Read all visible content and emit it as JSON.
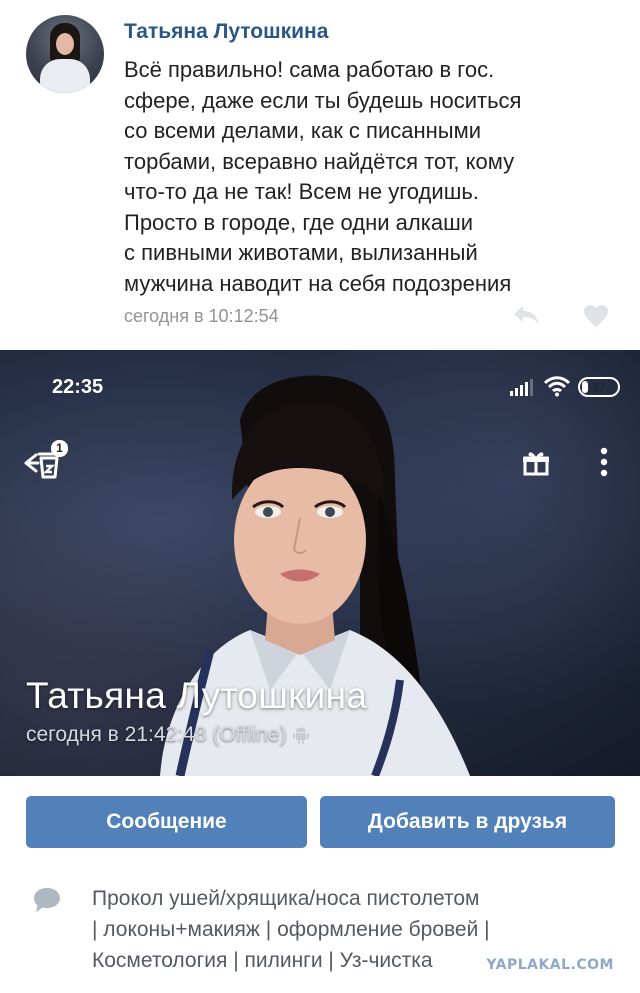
{
  "comment": {
    "author": "Татьяна Лутошкина",
    "lines": [
      "Всё правильно! сама работаю в гос.",
      "сфере, даже если ты будешь носиться",
      "со всеми делами, как с писанными",
      "торбами, всеравно найдётся тот, кому",
      "что-то да не так! Всем не угодишь.",
      "Просто в городе, где одни алкаши",
      "с пивными животами, вылизанный",
      "мужчина наводит на себя подозрения"
    ],
    "time": "сегодня в 10:12:54",
    "icons": {
      "avatar": "avatar-photo",
      "reply": "reply-icon",
      "like": "heart-icon"
    }
  },
  "statusbar": {
    "time": "22:35",
    "battery": "27",
    "battery_level": 0.27
  },
  "navbar": {
    "badge": "1",
    "icons": {
      "back": "back-arrow-icon",
      "gift": "gift-icon",
      "more": "more-vertical-icon"
    }
  },
  "profile": {
    "name": "Татьяна Лутошкина",
    "last_seen": "сегодня в 21:42:48 (Offline)",
    "platform_icon": "android-icon"
  },
  "actions": {
    "message_label": "Сообщение",
    "add_friend_label": "Добавить в друзья"
  },
  "status": {
    "lines": [
      "Прокол ушей/хрящика/носа пистолетом",
      "| локоны+макияж | оформление бровей |",
      "Косметология | пилинги | Уз-чистка"
    ],
    "icon": "chat-bubble-icon"
  },
  "watermark": "YAPLAKAL.COM",
  "colors": {
    "link": "#2a5885",
    "button": "#5181b8",
    "meta": "#939393"
  }
}
